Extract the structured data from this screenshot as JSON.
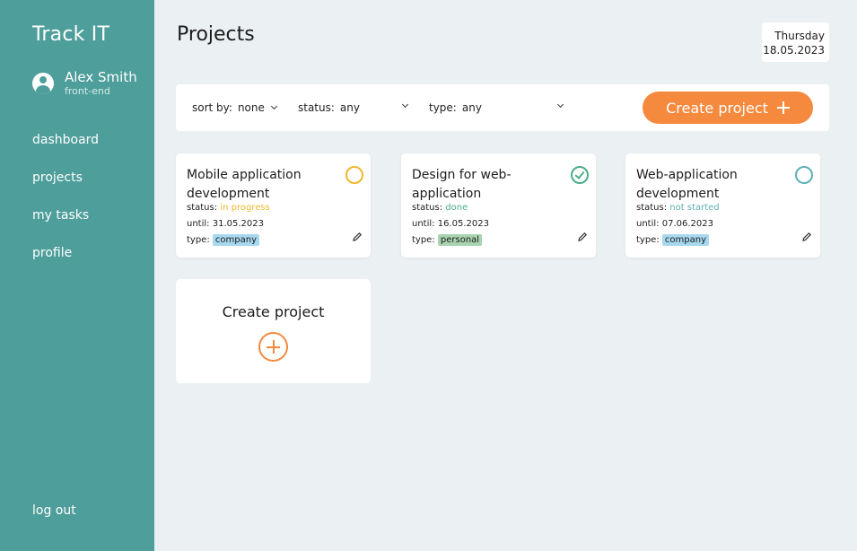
{
  "app": {
    "logo": "Track IT"
  },
  "user": {
    "name": "Alex Smith",
    "role": "front-end"
  },
  "nav": {
    "items": [
      {
        "label": "dashboard"
      },
      {
        "label": "projects"
      },
      {
        "label": "my tasks"
      },
      {
        "label": "profile"
      }
    ],
    "logout": "log out"
  },
  "header": {
    "title": "Projects",
    "day": "Thursday",
    "date": "18.05.2023"
  },
  "toolbar": {
    "sort_label": "sort by:",
    "sort_value": "none",
    "status_label": "status:",
    "status_value": "any",
    "type_label": "type:",
    "type_value": "any",
    "create_label": "Create project"
  },
  "projects": [
    {
      "title": "Mobile application development",
      "status_label": "status:",
      "status": "in progress",
      "until_label": "until:",
      "until": "31.05.2023",
      "type_label": "type:",
      "type": "company",
      "status_color": "#f2b72d",
      "icon": "circle-outline-icon"
    },
    {
      "title": "Design for web-application",
      "status_label": "status:",
      "status": "done",
      "until_label": "until:",
      "until": "16.05.2023",
      "type_label": "type:",
      "type": "personal",
      "status_color": "#4cae87",
      "icon": "check-circle-icon"
    },
    {
      "title": "Web-application development",
      "status_label": "status:",
      "status": "not started",
      "until_label": "until:",
      "until": "07.06.2023",
      "type_label": "type:",
      "type": "company",
      "status_color": "#5eb0b4",
      "icon": "circle-outline-icon"
    }
  ],
  "create_card": {
    "label": "Create project"
  },
  "colors": {
    "sidebar": "#4e9e9b",
    "accent": "#f5893d",
    "company_badge": "#a8d8ef",
    "personal_badge": "#a9d4b0"
  }
}
